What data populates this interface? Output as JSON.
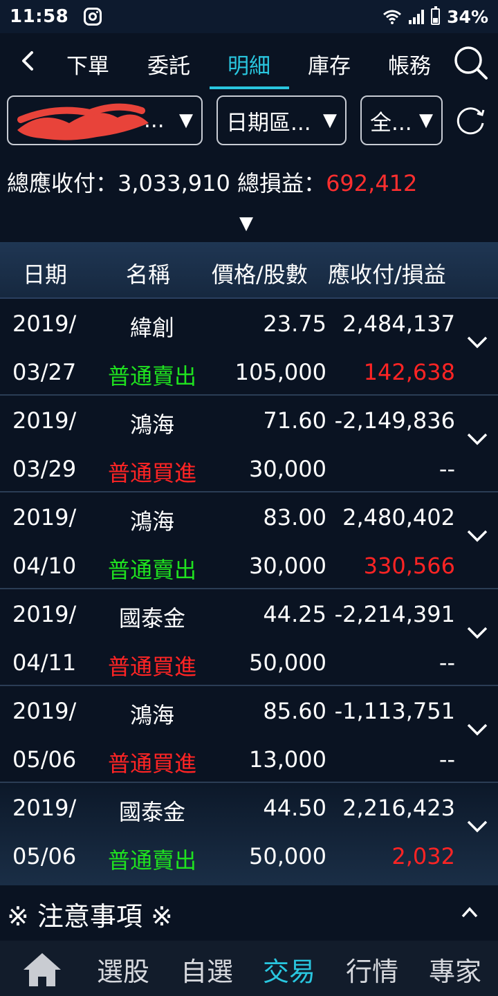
{
  "status_bar": {
    "time": "11:58",
    "battery": "34%"
  },
  "nav": {
    "tabs": [
      "下單",
      "委託",
      "明細",
      "庫存",
      "帳務"
    ],
    "active_index": 2
  },
  "filters": {
    "account_suffix": "...",
    "date_range": "日期區...",
    "type": "全..."
  },
  "summary": {
    "receivable_label": "總應收付：",
    "receivable_value": "3,033,910",
    "pnl_label": "總損益：",
    "pnl_value": "692,412"
  },
  "table": {
    "headers": [
      "日期",
      "名稱",
      "價格/股數",
      "應收付/損益"
    ],
    "rows": [
      {
        "year": "2019/",
        "date": "03/27",
        "name": "緯創",
        "type": "普通賣出",
        "side": "sell",
        "price": "23.75",
        "shares": "105,000",
        "amount": "2,484,137",
        "pnl": "142,638"
      },
      {
        "year": "2019/",
        "date": "03/29",
        "name": "鴻海",
        "type": "普通買進",
        "side": "buy",
        "price": "71.60",
        "shares": "30,000",
        "amount": "-2,149,836",
        "pnl": "--"
      },
      {
        "year": "2019/",
        "date": "04/10",
        "name": "鴻海",
        "type": "普通賣出",
        "side": "sell",
        "price": "83.00",
        "shares": "30,000",
        "amount": "2,480,402",
        "pnl": "330,566"
      },
      {
        "year": "2019/",
        "date": "04/11",
        "name": "國泰金",
        "type": "普通買進",
        "side": "buy",
        "price": "44.25",
        "shares": "50,000",
        "amount": "-2,214,391",
        "pnl": "--"
      },
      {
        "year": "2019/",
        "date": "05/06",
        "name": "鴻海",
        "type": "普通買進",
        "side": "buy",
        "price": "85.60",
        "shares": "13,000",
        "amount": "-1,113,751",
        "pnl": "--"
      },
      {
        "year": "2019/",
        "date": "05/06",
        "name": "國泰金",
        "type": "普通賣出",
        "side": "sell",
        "price": "44.50",
        "shares": "50,000",
        "amount": "2,216,423",
        "pnl": "2,032"
      }
    ]
  },
  "notice": {
    "label": "※ 注意事項 ※"
  },
  "bottom_nav": {
    "items": [
      "選股",
      "自選",
      "交易",
      "行情",
      "專家"
    ],
    "active_index": 2
  },
  "colors": {
    "accent": "#29c6df",
    "sell": "#1fe21f",
    "buy_or_profit": "#ff2424",
    "background": "#0a1322"
  }
}
